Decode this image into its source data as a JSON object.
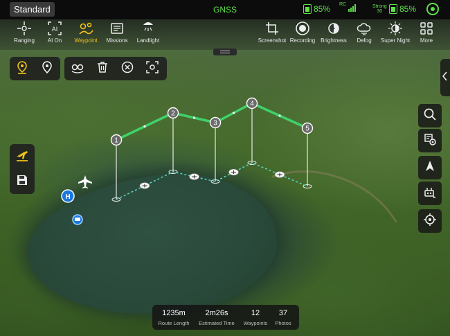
{
  "topbar": {
    "mode": "Standard",
    "signal": "GNSS",
    "rc_battery": "85%",
    "rc_signal_tag": "RC",
    "link_strength": "Strong",
    "link_value": "30",
    "aircraft_battery": "85%",
    "accent_color": "#5fe04a"
  },
  "toolbar": {
    "left": [
      {
        "label": "Ranging",
        "icon": "ranging-icon"
      },
      {
        "label": "AI On",
        "icon": "ai-icon"
      },
      {
        "label": "Waypoint",
        "icon": "waypoint-icon",
        "active": true
      },
      {
        "label": "Missions",
        "icon": "missions-icon"
      },
      {
        "label": "Landlight",
        "icon": "landlight-icon"
      }
    ],
    "right": [
      {
        "label": "Screenshot",
        "icon": "screenshot-icon"
      },
      {
        "label": "Recording",
        "icon": "record-icon"
      },
      {
        "label": "Brightness",
        "icon": "brightness-icon"
      },
      {
        "label": "Defog",
        "icon": "defog-icon"
      },
      {
        "label": "Super Night",
        "icon": "super-night-icon"
      },
      {
        "label": "More",
        "icon": "more-icon"
      }
    ],
    "active_color": "#f2c21b"
  },
  "waypoint_panel": {
    "tools": [
      "add-waypoint-icon",
      "add-poi-icon"
    ],
    "edit_tools": [
      "link-icon",
      "delete-icon",
      "clear-icon",
      "frame-icon"
    ]
  },
  "left_actions": [
    "takeoff-icon",
    "save-icon"
  ],
  "right_actions": [
    "search-icon",
    "route-settings-icon",
    "compass-icon",
    "aircraft-settings-icon",
    "locate-icon"
  ],
  "waypoints": [
    {
      "label": "1"
    },
    {
      "label": "2"
    },
    {
      "label": "3"
    },
    {
      "label": "4"
    },
    {
      "label": "5"
    }
  ],
  "map_markers": {
    "home": "H",
    "route_color": "#3fd26a"
  },
  "route_stats": [
    {
      "value": "1235m",
      "label": "Route Length"
    },
    {
      "value": "2m26s",
      "label": "Estimated Time"
    },
    {
      "value": "12",
      "label": "Waypoints"
    },
    {
      "value": "37",
      "label": "Photos"
    }
  ]
}
